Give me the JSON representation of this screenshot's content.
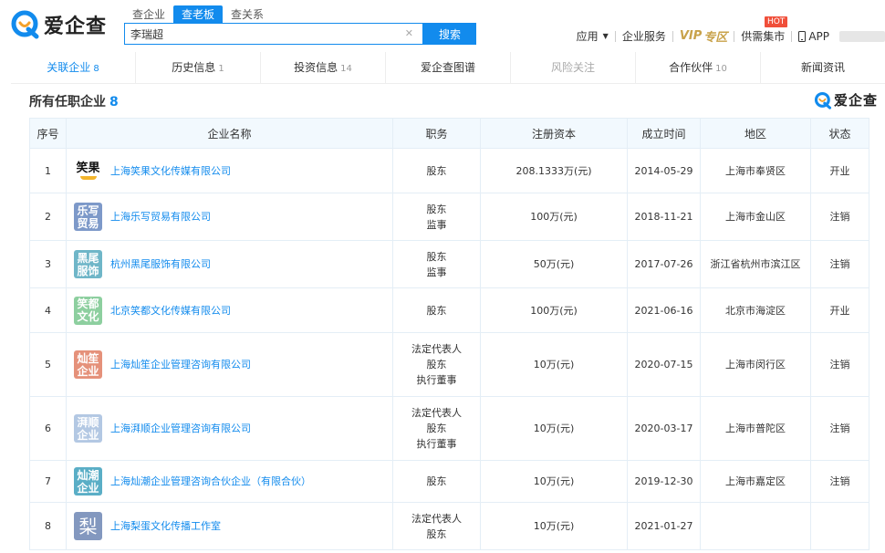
{
  "header": {
    "logo_text": "爱企查",
    "search_tabs": [
      "查企业",
      "查老板",
      "查关系"
    ],
    "search_value": "李瑞超",
    "search_button": "搜索",
    "nav": {
      "apps": "应用",
      "enterprise_service": "企业服务",
      "vip": "VIP",
      "vip_zone": "专区",
      "supply": "供需集市",
      "hot": "HOT",
      "app": "APP"
    }
  },
  "subtabs": [
    {
      "label": "关联企业",
      "count": "8"
    },
    {
      "label": "历史信息",
      "count": "1"
    },
    {
      "label": "投资信息",
      "count": "14"
    },
    {
      "label": "爱企查图谱",
      "count": ""
    },
    {
      "label": "风险关注",
      "count": ""
    },
    {
      "label": "合作伙伴",
      "count": "10"
    },
    {
      "label": "新闻资讯",
      "count": ""
    }
  ],
  "section": {
    "title": "所有任职企业",
    "count": "8",
    "logo_text": "爱企查"
  },
  "table": {
    "headers": [
      "序号",
      "企业名称",
      "职务",
      "注册资本",
      "成立时间",
      "地区",
      "状态"
    ],
    "rows": [
      {
        "no": "1",
        "logo": "笑果",
        "logo_style": "white",
        "logo_color": "#ffffff",
        "name": "上海笑果文化传媒有限公司",
        "roles": [
          "股东"
        ],
        "capital": "208.1333万(元)",
        "date": "2014-05-29",
        "region": "上海市奉贤区",
        "status": "开业",
        "status_type": "open"
      },
      {
        "no": "2",
        "logo": "乐写贸易",
        "logo_style": "text",
        "logo_color": "#7d99c9",
        "name": "上海乐写贸易有限公司",
        "roles": [
          "股东",
          "监事"
        ],
        "capital": "100万(元)",
        "date": "2018-11-21",
        "region": "上海市金山区",
        "status": "注销",
        "status_type": "closed"
      },
      {
        "no": "3",
        "logo": "黑尾服饰",
        "logo_style": "text",
        "logo_color": "#6fb6c8",
        "name": "杭州黑尾服饰有限公司",
        "roles": [
          "股东",
          "监事"
        ],
        "capital": "50万(元)",
        "date": "2017-07-26",
        "region": "浙江省杭州市滨江区",
        "status": "注销",
        "status_type": "closed"
      },
      {
        "no": "4",
        "logo": "笑都文化",
        "logo_style": "text",
        "logo_color": "#8dcf9f",
        "name": "北京笑都文化传媒有限公司",
        "roles": [
          "股东"
        ],
        "capital": "100万(元)",
        "date": "2021-06-16",
        "region": "北京市海淀区",
        "status": "开业",
        "status_type": "open"
      },
      {
        "no": "5",
        "logo": "灿笙企业",
        "logo_style": "text",
        "logo_color": "#e5917a",
        "name": "上海灿笙企业管理咨询有限公司",
        "roles": [
          "法定代表人",
          "股东",
          "执行董事"
        ],
        "capital": "10万(元)",
        "date": "2020-07-15",
        "region": "上海市闵行区",
        "status": "注销",
        "status_type": "closed"
      },
      {
        "no": "6",
        "logo": "湃顺企业",
        "logo_style": "text",
        "logo_color": "#b3c8e3",
        "name": "上海湃顺企业管理咨询有限公司",
        "roles": [
          "法定代表人",
          "股东",
          "执行董事"
        ],
        "capital": "10万(元)",
        "date": "2020-03-17",
        "region": "上海市普陀区",
        "status": "注销",
        "status_type": "closed"
      },
      {
        "no": "7",
        "logo": "灿潮企业",
        "logo_style": "text",
        "logo_color": "#5aaec6",
        "name": "上海灿潮企业管理咨询合伙企业（有限合伙）",
        "roles": [
          "股东"
        ],
        "capital": "10万(元)",
        "date": "2019-12-30",
        "region": "上海市嘉定区",
        "status": "注销",
        "status_type": "closed"
      },
      {
        "no": "8",
        "logo": "梨",
        "logo_style": "big",
        "logo_color": "#8398bf",
        "name": "上海梨蛋文化传播工作室",
        "roles": [
          "法定代表人",
          "股东"
        ],
        "capital": "10万(元)",
        "date": "2021-01-27",
        "region": "",
        "status": "",
        "status_type": "none"
      }
    ]
  },
  "colors": {
    "brand": "#128bed",
    "vip": "#c8a24a",
    "hot": "#f04f3a",
    "status_open": "#4ba66a",
    "status_closed": "#e8553f"
  }
}
